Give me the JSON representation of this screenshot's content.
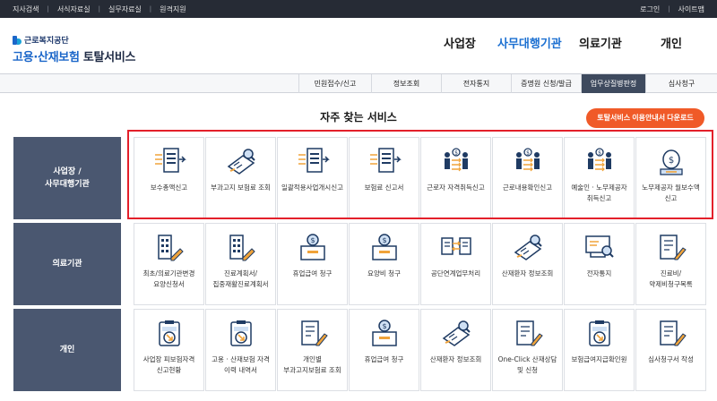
{
  "util_nav": {
    "left": [
      "지사검색",
      "서식자료실",
      "실무자료실",
      "원격지원"
    ],
    "right": [
      "로그인",
      "사이트맵"
    ]
  },
  "logo": {
    "org": "근로복지공단",
    "service_blue": "고용·산재보험",
    "service_dark": "토탈서비스"
  },
  "gnb": [
    "사업장",
    "사무대행기관",
    "의료기관",
    "개인"
  ],
  "gnb_active": "사무대행기관",
  "subnav": [
    "민원접수/신고",
    "정보조회",
    "전자통지",
    "증명원 신청/발급",
    "업무상질병판정",
    "심사청구"
  ],
  "subnav_active": "업무상질병판정",
  "section_title": "자주 찾는 서비스",
  "download_button": "토탈서비스 이용안내서 다운로드",
  "accent_colors": {
    "primary": "#1b6fd1",
    "orange": "#f05a28",
    "highlight": "#e3202a",
    "category_bg": "#4a5770"
  },
  "rows": [
    {
      "category": [
        "사업장 /",
        "사무대행기관"
      ],
      "items": [
        {
          "icon": "list-arrows-icon",
          "label": "보수총액신고"
        },
        {
          "icon": "report-search-icon",
          "label": "부과고지 보험료 조회"
        },
        {
          "icon": "list-arrows-icon",
          "label": "일괄적용사업개시신고"
        },
        {
          "icon": "list-arrows-icon",
          "label": "보험료 신고서"
        },
        {
          "icon": "worker-dollar-icon",
          "label": "근로자 자격취득신고"
        },
        {
          "icon": "worker-dollar-icon",
          "label": "근로내용확인신고"
        },
        {
          "icon": "worker-dollar-icon",
          "label": "예술인 · 노무제공자 취득신고"
        },
        {
          "icon": "money-bag-icon",
          "label": "노무제공자 월보수액 신고"
        }
      ]
    },
    {
      "category": [
        "의료기관"
      ],
      "items": [
        {
          "icon": "building-pen-icon",
          "label": "최초/의료기관변경 요양신청서"
        },
        {
          "icon": "building-pen-icon",
          "label": "진료계획서/집중재활진료계획서"
        },
        {
          "icon": "coin-box-icon",
          "label": "휴업급여 청구"
        },
        {
          "icon": "coin-box-icon",
          "label": "요양비 청구"
        },
        {
          "icon": "document-exchange-icon",
          "label": "공단연계업무처리"
        },
        {
          "icon": "report-search-icon",
          "label": "산재환자 정보조회"
        },
        {
          "icon": "monitor-search-icon",
          "label": "전자통지"
        },
        {
          "icon": "document-pen-icon",
          "label": "진료비/약제비청구목록"
        }
      ]
    },
    {
      "category": [
        "개인"
      ],
      "items": [
        {
          "icon": "clipboard-arrow-icon",
          "label": "사업장 피보험자격 신고현황"
        },
        {
          "icon": "clipboard-arrow-icon",
          "label": "고용 · 산재보험 자격 이력 내역서"
        },
        {
          "icon": "document-pen-icon",
          "label": "개인별 부과고지보험료 조회"
        },
        {
          "icon": "coin-box-icon",
          "label": "휴업급여 청구"
        },
        {
          "icon": "report-search-icon",
          "label": "산재환자 정보조회"
        },
        {
          "icon": "document-pen-icon",
          "label": "One-Click 산재상담 및 신청"
        },
        {
          "icon": "clipboard-arrow-icon",
          "label": "보험급여지급확인원"
        },
        {
          "icon": "document-pen-icon",
          "label": "심사청구서 작성"
        }
      ]
    }
  ]
}
